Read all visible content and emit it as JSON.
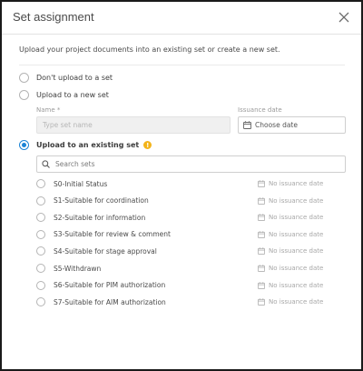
{
  "dialog": {
    "title": "Set assignment",
    "intro": "Upload your project documents into an existing set or create a new set."
  },
  "options": {
    "dont_upload": "Don't upload to a set",
    "new_set": "Upload to a new set",
    "existing_set": "Upload to an existing set",
    "selected": "existing_set"
  },
  "new_set_form": {
    "name_label": "Name *",
    "name_placeholder": "Type set name",
    "date_label": "Issuance date",
    "date_placeholder": "Choose date"
  },
  "search": {
    "placeholder": "Search sets"
  },
  "sets": [
    {
      "label": "S0-Initial Status",
      "date": "No issuance date"
    },
    {
      "label": "S1-Suitable for coordination",
      "date": "No issuance date"
    },
    {
      "label": "S2-Suitable for information",
      "date": "No issuance date"
    },
    {
      "label": "S3-Suitable for review & comment",
      "date": "No issuance date"
    },
    {
      "label": "S4-Suitable for stage approval",
      "date": "No issuance date"
    },
    {
      "label": "S5-Withdrawn",
      "date": "No issuance date"
    },
    {
      "label": "S6-Suitable for PIM authorization",
      "date": "No issuance date"
    },
    {
      "label": "S7-Suitable for AIM authorization",
      "date": "No issuance date"
    }
  ],
  "colors": {
    "accent": "#1c84d6",
    "warning": "#f3b41b"
  }
}
